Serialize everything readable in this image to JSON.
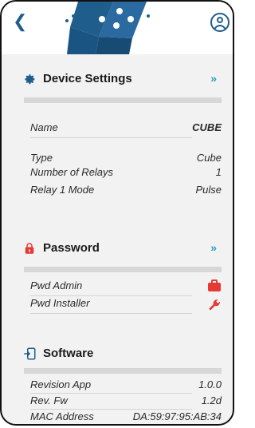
{
  "header": {
    "back_icon": "back-chevron-icon",
    "logo_icon": "cube-logo-icon",
    "avatar_icon": "user-circle-icon",
    "accent_color": "#1f5d8c"
  },
  "sections": {
    "device": {
      "title": "Device Settings",
      "icon": "gear-icon",
      "chevron": "»",
      "rows": {
        "name": {
          "label": "Name",
          "value": "CUBE"
        },
        "type": {
          "label": "Type",
          "value": "Cube"
        },
        "relays": {
          "label": "Number of Relays",
          "value": "1"
        },
        "mode": {
          "label": "Relay 1 Mode",
          "value": "Pulse"
        }
      }
    },
    "password": {
      "title": "Password",
      "icon": "lock-icon",
      "chevron": "»",
      "rows": {
        "admin": {
          "label": "Pwd Admin",
          "icon": "briefcase-icon"
        },
        "installer": {
          "label": "Pwd Installer",
          "icon": "wrench-icon"
        }
      }
    },
    "software": {
      "title": "Software",
      "icon": "import-icon",
      "rows": {
        "app": {
          "label": "Revision App",
          "value": "1.0.0"
        },
        "fw": {
          "label": "Rev. Fw",
          "value": "1.2d"
        },
        "mac": {
          "label": "MAC Address",
          "value": "DA:59:97:95:AB:34"
        }
      }
    }
  },
  "colors": {
    "chevron": "#2a9db7",
    "red": "#e53935"
  }
}
